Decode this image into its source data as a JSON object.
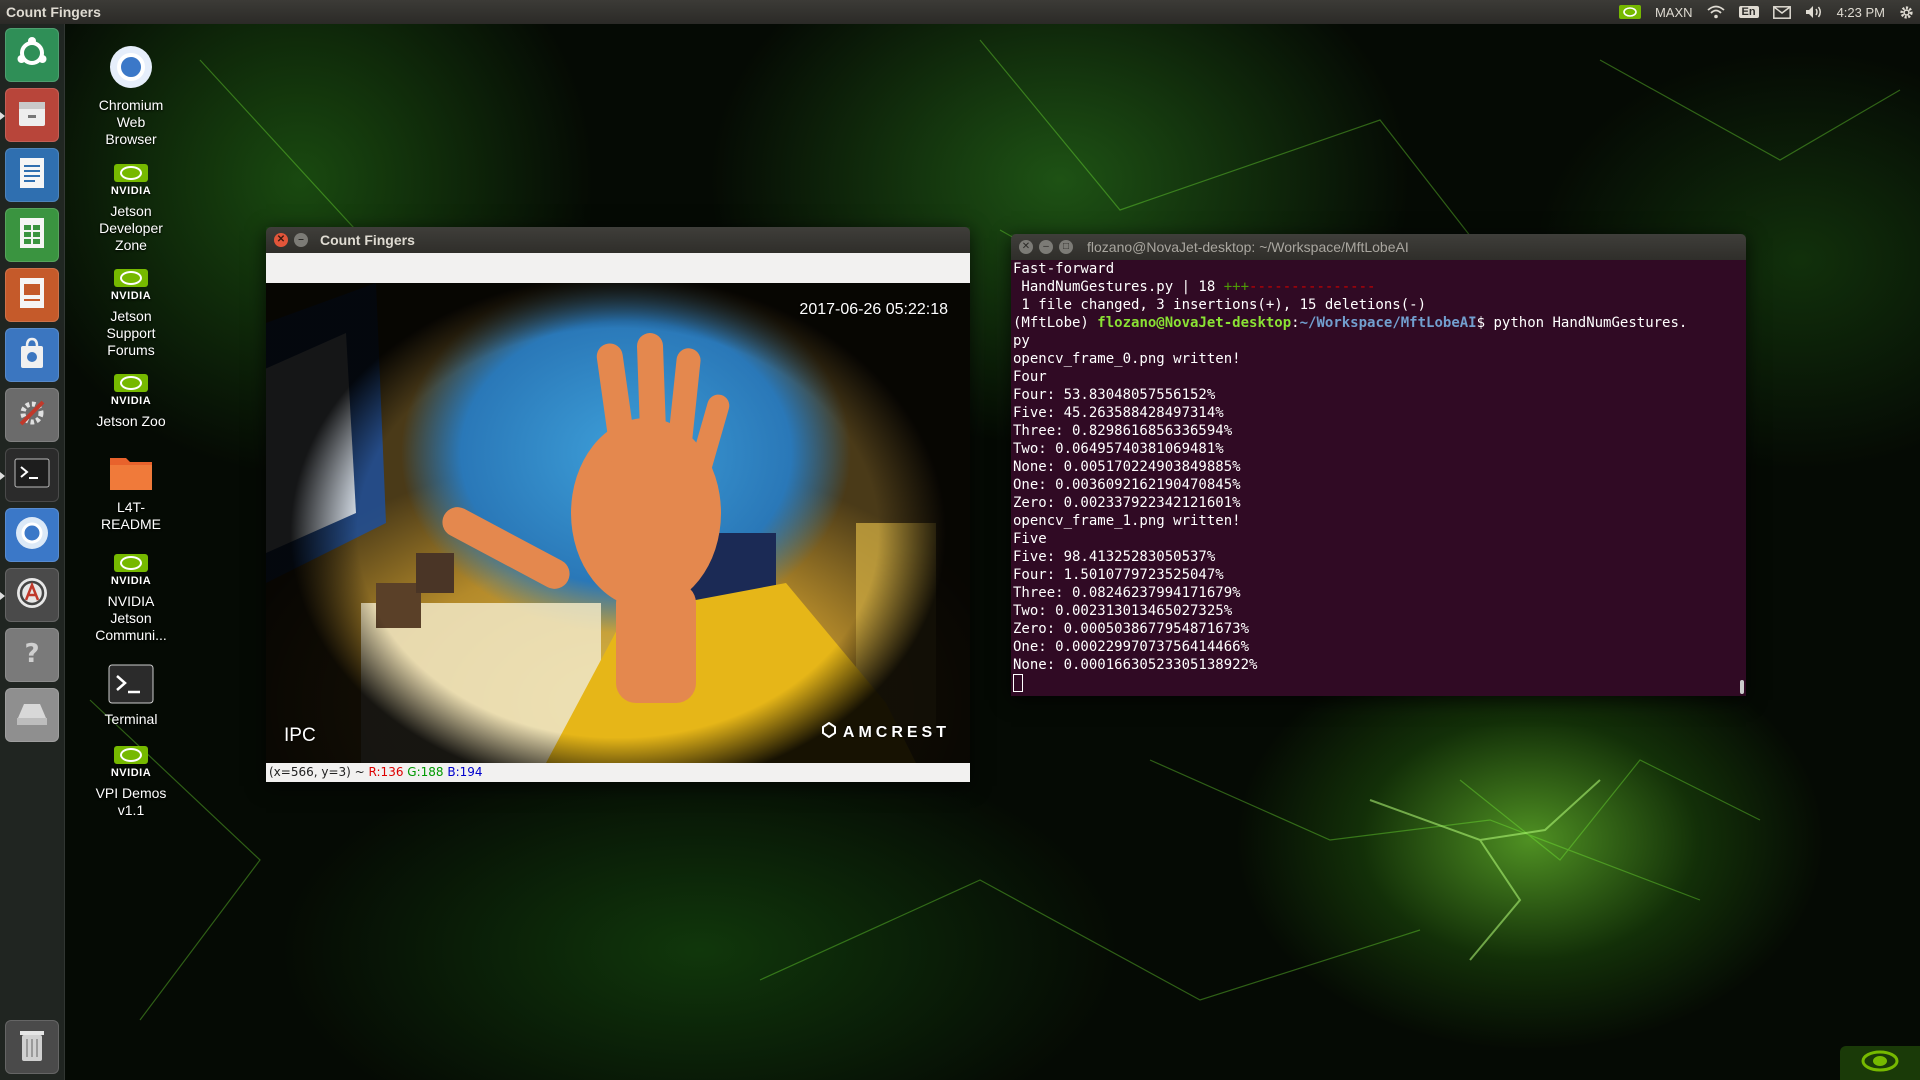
{
  "top_panel": {
    "app_title": "Count Fingers",
    "power_mode": "MAXN",
    "keyboard_layout": "En",
    "clock": "4:23 PM",
    "icons": [
      "nvidia-icon",
      "wifi-icon",
      "mail-icon",
      "volume-icon",
      "settings-gear-icon"
    ]
  },
  "launcher": {
    "items": [
      {
        "name": "ubuntu-dash",
        "icon": "ubuntu-logo-icon",
        "color": "#3fa56a"
      },
      {
        "name": "files",
        "icon": "file-cabinet-icon",
        "color": "#b8453a"
      },
      {
        "name": "libreoffice-writer",
        "icon": "writer-doc-icon",
        "color": "#3c7fc0"
      },
      {
        "name": "libreoffice-calc",
        "icon": "calc-sheet-icon",
        "color": "#3e9b43"
      },
      {
        "name": "libreoffice-impress",
        "icon": "impress-slides-icon",
        "color": "#c55a2a"
      },
      {
        "name": "software-center",
        "icon": "shopping-bag-icon",
        "color": "#3b76c0"
      },
      {
        "name": "system-settings",
        "icon": "settings-tools-icon",
        "color": "#c0392b"
      },
      {
        "name": "terminal",
        "icon": "terminal-icon",
        "color": "#3a3a3a"
      },
      {
        "name": "chromium",
        "icon": "chromium-icon",
        "color": "#3b78c8"
      },
      {
        "name": "software-updater",
        "icon": "updater-icon",
        "color": "#5a5a5a"
      },
      {
        "name": "help",
        "icon": "help-icon",
        "color": "#777777"
      },
      {
        "name": "drive",
        "icon": "drive-icon",
        "color": "#9a9a9a"
      },
      {
        "name": "trash",
        "icon": "trash-icon",
        "color": "#555555"
      }
    ]
  },
  "desktop_icons": [
    {
      "label_lines": [
        "Chromium",
        "Web",
        "Browser"
      ],
      "icon": "chromium-icon"
    },
    {
      "label_lines": [
        "Jetson",
        "Developer",
        "Zone"
      ],
      "icon": "nvidia-icon",
      "logo_text": "NVIDIA"
    },
    {
      "label_lines": [
        "Jetson",
        "Support",
        "Forums"
      ],
      "icon": "nvidia-icon",
      "logo_text": "NVIDIA"
    },
    {
      "label_lines": [
        "Jetson Zoo"
      ],
      "icon": "nvidia-icon",
      "logo_text": "NVIDIA"
    },
    {
      "label_lines": [
        "L4T-",
        "README"
      ],
      "icon": "folder-icon"
    },
    {
      "label_lines": [
        "NVIDIA",
        "Jetson",
        "Communi..."
      ],
      "icon": "nvidia-icon",
      "logo_text": "NVIDIA"
    },
    {
      "label_lines": [
        "Terminal"
      ],
      "icon": "terminal-icon"
    },
    {
      "label_lines": [
        "VPI Demos",
        "v1.1"
      ],
      "icon": "nvidia-icon",
      "logo_text": "NVIDIA"
    }
  ],
  "count_fingers_window": {
    "title": "Count Fingers",
    "camera": {
      "timestamp": "2017-06-26 05:22:18",
      "overlay_left": "IPC",
      "overlay_brand": "AMCREST"
    },
    "status": {
      "coords": "(x=566, y=3) ~",
      "r": "R:136",
      "g": "G:188",
      "b": "B:194"
    }
  },
  "terminal_window": {
    "title": "flozano@NovaJet-desktop: ~/Workspace/MftLobeAI",
    "lines": [
      {
        "type": "plain",
        "text": "Fast-forward"
      },
      {
        "type": "diffstat",
        "text": " HandNumGestures.py | 18 ",
        "plus": "+++",
        "minus": "---------------"
      },
      {
        "type": "plain",
        "text": " 1 file changed, 3 insertions(+), 15 deletions(-)"
      },
      {
        "type": "prompt",
        "env": "(MftLobe) ",
        "user": "flozano@NovaJet-desktop",
        "path": "~/Workspace/MftLobeAI",
        "cmd": "$ python HandNumGestures."
      },
      {
        "type": "plain",
        "text": "py"
      },
      {
        "type": "plain",
        "text": "opencv_frame_0.png written!"
      },
      {
        "type": "plain",
        "text": "Four"
      },
      {
        "type": "plain",
        "text": "Four: 53.83048057556152%"
      },
      {
        "type": "plain",
        "text": "Five: 45.263588428497314%"
      },
      {
        "type": "plain",
        "text": "Three: 0.8298616856336594%"
      },
      {
        "type": "plain",
        "text": "Two: 0.06495740381069481%"
      },
      {
        "type": "plain",
        "text": "None: 0.005170224903849885%"
      },
      {
        "type": "plain",
        "text": "One: 0.0036092162190470845%"
      },
      {
        "type": "plain",
        "text": "Zero: 0.002337922342121601%"
      },
      {
        "type": "plain",
        "text": "opencv_frame_1.png written!"
      },
      {
        "type": "plain",
        "text": "Five"
      },
      {
        "type": "plain",
        "text": "Five: 98.41325283050537%"
      },
      {
        "type": "plain",
        "text": "Four: 1.5010779723525047%"
      },
      {
        "type": "plain",
        "text": "Three: 0.08246237994171679%"
      },
      {
        "type": "plain",
        "text": "Two: 0.002313013465027325%"
      },
      {
        "type": "plain",
        "text": "Zero: 0.0005038677954871673%"
      },
      {
        "type": "plain",
        "text": "One: 0.00022997073756414466%"
      },
      {
        "type": "plain",
        "text": "None: 0.00016630523305138922%"
      }
    ]
  },
  "colors": {
    "panel_bg": "#2b2a27",
    "terminal_bg": "#300a24",
    "close_button": "#e2553a",
    "nvidia_green": "#76b900"
  }
}
